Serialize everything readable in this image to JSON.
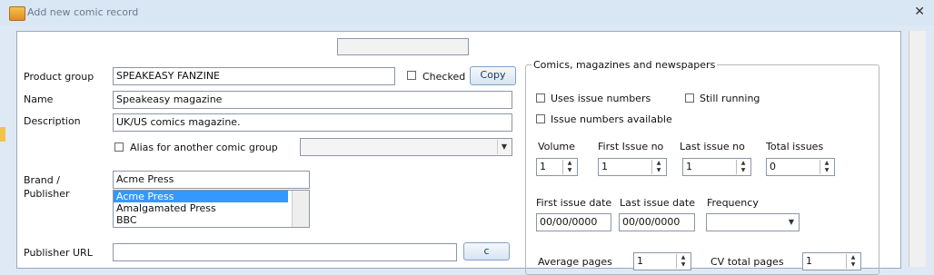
{
  "window": {
    "title": "Add new comic record"
  },
  "form": {
    "product_group": {
      "label": "Product group",
      "value": "SPEAKEASY FANZINE"
    },
    "checked": {
      "label": "Checked"
    },
    "copy_button": "Copy",
    "name": {
      "label": "Name",
      "value": "Speakeasy magazine"
    },
    "description": {
      "label": "Description",
      "value": "UK/US comics magazine."
    },
    "alias": {
      "label": "Alias for another comic group"
    },
    "brand": {
      "label_line1": "Brand /",
      "label_line2": "Publisher",
      "value": "Acme Press",
      "options": [
        "Acme Press",
        "Amalgamated Press",
        "BBC"
      ],
      "selected_index": 0
    },
    "publisher_url": {
      "label": "Publisher URL",
      "value": "",
      "button": "c"
    }
  },
  "comics_group": {
    "title": "Comics, magazines and newspapers",
    "uses_issue_numbers": "Uses issue numbers",
    "still_running": "Still running",
    "issue_numbers_available": "Issue numbers available",
    "volume": {
      "label": "Volume",
      "value": "1"
    },
    "first_issue_no": {
      "label": "First Issue no",
      "value": "1"
    },
    "last_issue_no": {
      "label": "Last issue no",
      "value": "1"
    },
    "total_issues": {
      "label": "Total issues",
      "value": "0"
    },
    "first_issue_date": {
      "label": "First issue date",
      "value": "00/00/0000"
    },
    "last_issue_date": {
      "label": "Last issue date",
      "value": "00/00/0000"
    },
    "frequency": {
      "label": "Frequency",
      "value": ""
    },
    "average_pages": {
      "label": "Average pages",
      "value": "1"
    },
    "cv_total_pages": {
      "label": "CV total pages",
      "value": "1"
    }
  },
  "icons": [
    "app-icon",
    "close-icon",
    "dropdown-arrow-icon",
    "spin-arrows-icon"
  ]
}
